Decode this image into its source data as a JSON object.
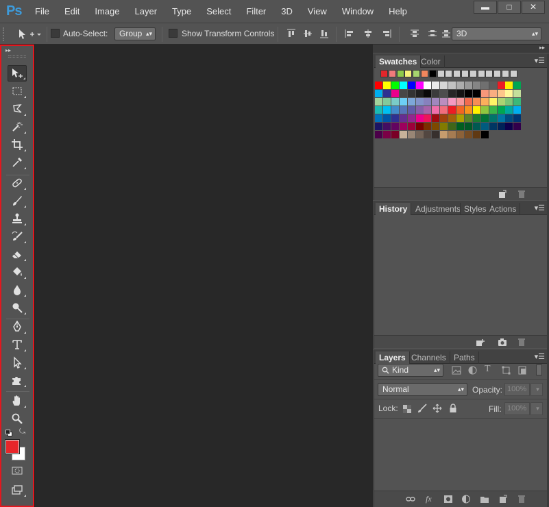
{
  "app": {
    "logo": "Ps",
    "menu": [
      "File",
      "Edit",
      "Image",
      "Layer",
      "Type",
      "Select",
      "Filter",
      "3D",
      "View",
      "Window",
      "Help"
    ],
    "window_controls": {
      "minimize": "▬",
      "maximize": "□",
      "close": "✕"
    }
  },
  "options_bar": {
    "auto_select_label": "Auto-Select:",
    "auto_select_value": "Group",
    "show_transform_label": "Show Transform Controls",
    "mode_3d_value": "3D"
  },
  "tools": {
    "foreground_color": "#e8262a",
    "background_color": "#ffffff"
  },
  "swatches_panel": {
    "tabs": [
      "Swatches",
      "Color"
    ],
    "recent_colors": [
      "#e2262b",
      "#f07b7b",
      "#8fc94b",
      "#f7f17a",
      "#a7d56e",
      "#f2875d",
      "#000000",
      "#cfcfcf",
      "#cfcfcf",
      "#cfcfcf",
      "#cfcfcf",
      "#cfcfcf",
      "#cfcfcf",
      "#cfcfcf",
      "#cfcfcf",
      "#cfcfcf",
      "#cfcfcf"
    ],
    "rows": [
      [
        "#ff0000",
        "#ffff00",
        "#00ff00",
        "#00ffff",
        "#0000ff",
        "#ff00ff",
        "#ffffff",
        "#ebebeb",
        "#d6d6d6",
        "#c2c2c2",
        "#adadad",
        "#999999",
        "#858585",
        "#707070",
        "#5c5c5c",
        "#ed1c24",
        "#fff200",
        "#00a651"
      ],
      [
        "#00aeef",
        "#2e3192",
        "#ec008c",
        "#474747",
        "#333333",
        "#1f1f1f",
        "#0a0a0a",
        "#3b3b3b",
        "#4d4d4d",
        "#262626",
        "#141414",
        "#000000",
        "#000000",
        "#f7977a",
        "#f9ad81",
        "#fdc68a",
        "#fff79a",
        "#c4df9b"
      ],
      [
        "#a2d39c",
        "#82ca9c",
        "#7accc8",
        "#6dcff6",
        "#7da7d9",
        "#8393ca",
        "#8781bd",
        "#a187be",
        "#bc8dbf",
        "#f49ac2",
        "#f6989d",
        "#f26c4f",
        "#f68e55",
        "#fbaf5c",
        "#fff467",
        "#acd373",
        "#7cc576",
        "#3bb878"
      ],
      [
        "#1abbb4",
        "#00bff3",
        "#438ccb",
        "#5674b9",
        "#605ca8",
        "#855fa8",
        "#a763a8",
        "#f06eaa",
        "#f26d7d",
        "#ed1c24",
        "#f26522",
        "#f7941d",
        "#fff200",
        "#8dc73f",
        "#39b54a",
        "#00a651",
        "#00a99d",
        "#00aeef"
      ],
      [
        "#0072bc",
        "#0054a6",
        "#2e3192",
        "#662d91",
        "#92278f",
        "#ec008c",
        "#ed145b",
        "#9e0b0f",
        "#a0410d",
        "#a36209",
        "#aba000",
        "#598527",
        "#197b30",
        "#007236",
        "#00746b",
        "#0076a3",
        "#004b80",
        "#003471"
      ],
      [
        "#1b1464",
        "#440e62",
        "#630460",
        "#9e005d",
        "#9e0039",
        "#790000",
        "#7b2e00",
        "#7d4900",
        "#827b00",
        "#406618",
        "#005e20",
        "#005826",
        "#005952",
        "#005b7f",
        "#003663",
        "#002157",
        "#0d004c",
        "#32004b"
      ],
      [
        "#4b0049",
        "#7b0046",
        "#7a0026",
        "#c7b299",
        "#998675",
        "#736357",
        "#534741",
        "#37302d",
        "#c69c6d",
        "#a67c52",
        "#8c6239",
        "#754c24",
        "#603913",
        "#000000"
      ]
    ]
  },
  "history_panel": {
    "tabs": [
      "History",
      "Adjustments",
      "Styles",
      "Actions"
    ]
  },
  "layers_panel": {
    "tabs": [
      "Layers",
      "Channels",
      "Paths"
    ],
    "filter_value": "Kind",
    "blend_mode": "Normal",
    "opacity_label": "Opacity:",
    "opacity_value": "100%",
    "lock_label": "Lock:",
    "fill_label": "Fill:",
    "fill_value": "100%"
  }
}
